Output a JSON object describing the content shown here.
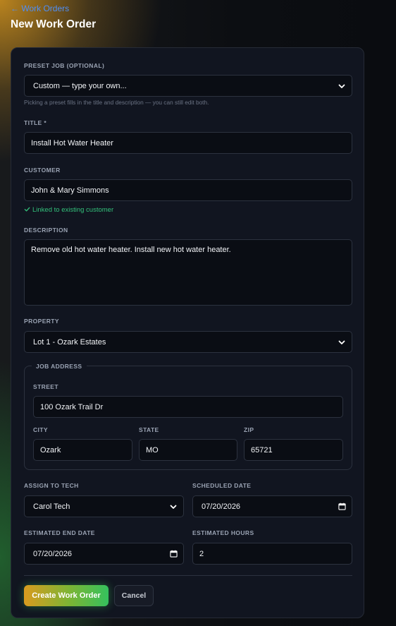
{
  "nav": {
    "back_label": "← Work Orders"
  },
  "page": {
    "title": "New Work Order"
  },
  "form": {
    "preset": {
      "label": "PRESET JOB (OPTIONAL)",
      "selected": "Custom — type your own...",
      "help": "Picking a preset fills in the title and description — you can still edit both."
    },
    "title": {
      "label": "TITLE *",
      "value": "Install Hot Water Heater"
    },
    "customer": {
      "label": "CUSTOMER",
      "value": "John & Mary Simmons",
      "status_icon": "check-icon",
      "status": "Linked to existing customer"
    },
    "description": {
      "label": "DESCRIPTION",
      "value": "Remove old hot water heater. Install new hot water heater."
    },
    "property": {
      "label": "PROPERTY",
      "selected": "Lot 1 - Ozark Estates"
    },
    "job_address": {
      "legend": "JOB ADDRESS",
      "street": {
        "label": "STREET",
        "value": "100 Ozark Trail Dr"
      },
      "city": {
        "label": "CITY",
        "value": "Ozark"
      },
      "state": {
        "label": "STATE",
        "value": "MO"
      },
      "zip": {
        "label": "ZIP",
        "value": "65721"
      }
    },
    "assign_tech": {
      "label": "ASSIGN TO TECH",
      "selected": "Carol Tech"
    },
    "scheduled_date": {
      "label": "SCHEDULED DATE",
      "value": "07/20/2026"
    },
    "estimated_end_date": {
      "label": "ESTIMATED END DATE",
      "value": "07/20/2026"
    },
    "estimated_hours": {
      "label": "ESTIMATED HOURS",
      "value": "2"
    }
  },
  "actions": {
    "create_label": "Create Work Order",
    "cancel_label": "Cancel"
  },
  "colors": {
    "accent_link": "#4f8ff7",
    "success": "#33c07a",
    "button_gradient_start": "#d99b1f",
    "button_gradient_end": "#35c15d"
  }
}
